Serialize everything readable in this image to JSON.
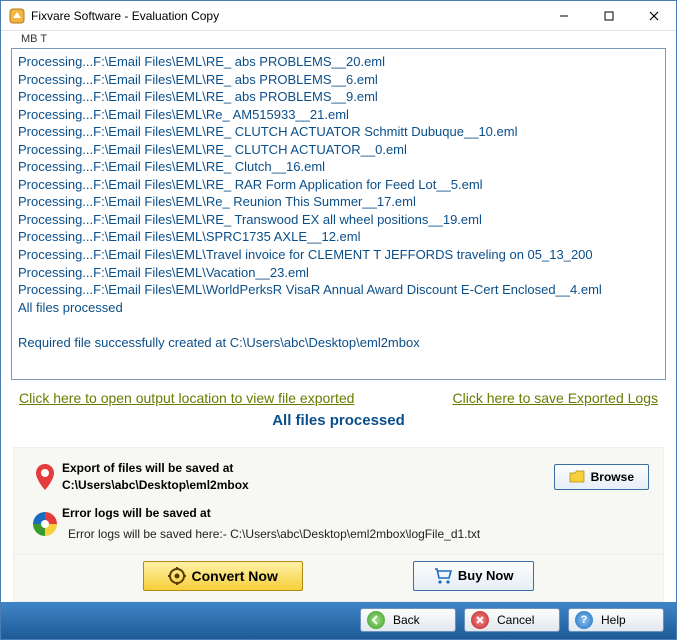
{
  "window": {
    "title": "Fixvare Software - Evaluation Copy",
    "sub_header": "MB     T"
  },
  "log_lines": [
    "Processing...F:\\Email Files\\EML\\RE_ abs PROBLEMS__20.eml",
    "Processing...F:\\Email Files\\EML\\RE_ abs PROBLEMS__6.eml",
    "Processing...F:\\Email Files\\EML\\RE_ abs PROBLEMS__9.eml",
    "Processing...F:\\Email Files\\EML\\Re_ AM515933__21.eml",
    "Processing...F:\\Email Files\\EML\\RE_ CLUTCH ACTUATOR Schmitt Dubuque__10.eml",
    "Processing...F:\\Email Files\\EML\\RE_ CLUTCH ACTUATOR__0.eml",
    "Processing...F:\\Email Files\\EML\\RE_ Clutch__16.eml",
    "Processing...F:\\Email Files\\EML\\RE_ RAR Form Application for Feed Lot__5.eml",
    "Processing...F:\\Email Files\\EML\\Re_ Reunion This Summer__17.eml",
    "Processing...F:\\Email Files\\EML\\RE_ Transwood EX all wheel positions__19.eml",
    "Processing...F:\\Email Files\\EML\\SPRC1735 AXLE__12.eml",
    "Processing...F:\\Email Files\\EML\\Travel invoice for CLEMENT T JEFFORDS traveling on 05_13_200",
    "Processing...F:\\Email Files\\EML\\Vacation__23.eml",
    "Processing...F:\\Email Files\\EML\\WorldPerksR VisaR Annual Award Discount E-Cert Enclosed__4.eml",
    "All files processed",
    "",
    "Required file successfully created at C:\\Users\\abc\\Desktop\\eml2mbox"
  ],
  "links": {
    "open_output": "Click here to open output location to view file exported",
    "save_logs": "Click here to save Exported Logs"
  },
  "status": "All files processed",
  "panel": {
    "export_label": "Export of files will be saved at",
    "export_path": "C:\\Users\\abc\\Desktop\\eml2mbox",
    "browse": "Browse",
    "error_label": "Error logs will be saved at",
    "error_sub": "Error logs will be saved here:- C:\\Users\\abc\\Desktop\\eml2mbox\\logFile_d1.txt",
    "convert": "Convert Now",
    "buy": "Buy Now"
  },
  "nav": {
    "back": "Back",
    "cancel": "Cancel",
    "help": "Help"
  }
}
